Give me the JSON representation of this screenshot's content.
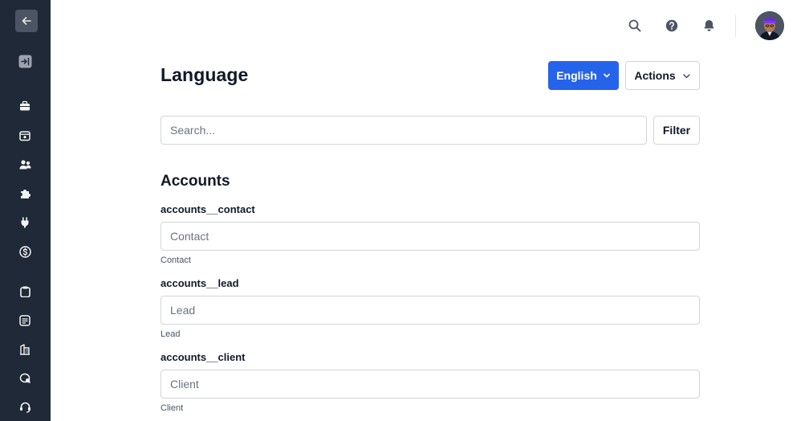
{
  "sidebar": {
    "icons": [
      "arrow-left-icon",
      "panel-expand-icon",
      "briefcase-icon",
      "inbox-icon",
      "users-icon",
      "puzzle-icon",
      "plug-icon",
      "dollar-circle-icon",
      "clipboard-icon",
      "document-icon",
      "building-icon",
      "chat-icon",
      "support-icon"
    ]
  },
  "topbar": {
    "icons": [
      "search-icon",
      "help-icon",
      "bell-icon"
    ]
  },
  "page": {
    "title": "Language",
    "language_button": "English",
    "actions_button": "Actions"
  },
  "search": {
    "placeholder": "Search...",
    "filter_label": "Filter"
  },
  "section": {
    "title": "Accounts",
    "fields": [
      {
        "key": "accounts__contact",
        "placeholder": "Contact",
        "help": "Contact"
      },
      {
        "key": "accounts__lead",
        "placeholder": "Lead",
        "help": "Lead"
      },
      {
        "key": "accounts__client",
        "placeholder": "Client",
        "help": "Client"
      }
    ]
  },
  "colors": {
    "sidebar_bg": "#1f2937",
    "primary": "#2563eb",
    "border": "#d1d5db"
  }
}
